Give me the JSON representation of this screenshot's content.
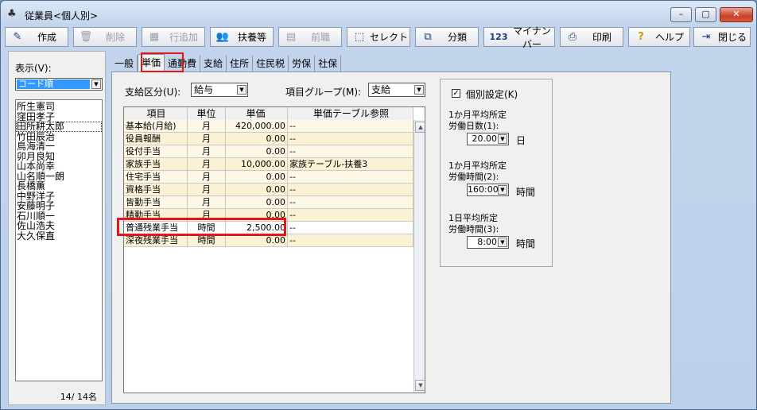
{
  "window": {
    "title": "従業員<個人別>",
    "min": "–",
    "max": "▢",
    "close": "✕"
  },
  "toolbar": {
    "create": "作成",
    "delete": "削除",
    "insert_row": "行追加",
    "dependents": "扶養等",
    "previous_job": "前職",
    "select": "セレクト",
    "classify": "分類",
    "my_number": "マイナンバー",
    "print": "印刷",
    "help": "ヘルプ",
    "close": "閉じる"
  },
  "left": {
    "display_label": "表示(V):",
    "sort_value": "コード順",
    "employees": [
      "所生憲司",
      "窪田孝子",
      "田所耕太郎",
      "竹田辰治",
      "鳥海清一",
      "卯月良知",
      "山本尚幸",
      "山名順一朗",
      "長橋薫",
      "中野洋子",
      "安藤明子",
      "石川順一",
      "佐山浩夫",
      "大久保直"
    ],
    "count": "14/ 14名"
  },
  "tabs": [
    "一般",
    "単価",
    "通勤費",
    "支給",
    "住所",
    "住民税",
    "労保",
    "社保"
  ],
  "form": {
    "pay_type_label": "支給区分(U):",
    "pay_type_value": "給与",
    "item_group_label": "項目グループ(M):",
    "item_group_value": "支給"
  },
  "grid": {
    "headers": [
      "項目",
      "単位",
      "単価",
      "単価テーブル参照"
    ],
    "rows": [
      {
        "item": "基本給(月給)",
        "unit": "月",
        "price": "420,000.00",
        "ref": "--"
      },
      {
        "item": "役員報酬",
        "unit": "月",
        "price": "0.00",
        "ref": "--"
      },
      {
        "item": "役付手当",
        "unit": "月",
        "price": "0.00",
        "ref": "--"
      },
      {
        "item": "家族手当",
        "unit": "月",
        "price": "10,000.00",
        "ref": "家族テーブル-扶養3"
      },
      {
        "item": "住宅手当",
        "unit": "月",
        "price": "0.00",
        "ref": "--"
      },
      {
        "item": "資格手当",
        "unit": "月",
        "price": "0.00",
        "ref": "--"
      },
      {
        "item": "皆勤手当",
        "unit": "月",
        "price": "0.00",
        "ref": "--"
      },
      {
        "item": "精勤手当",
        "unit": "月",
        "price": "0.00",
        "ref": "--"
      },
      {
        "item": "普通残業手当",
        "unit": "時間",
        "price": "2,500.00",
        "ref": "--"
      },
      {
        "item": "深夜残業手当",
        "unit": "時間",
        "price": "0.00",
        "ref": "--"
      }
    ]
  },
  "right": {
    "individual_label": "個別設定(K)",
    "checked_mark": "✓",
    "days_label1": "1か月平均所定",
    "days_label2": "労働日数(1):",
    "days_value": "20.00",
    "days_unit": "日",
    "hours_label1": "1か月平均所定",
    "hours_label2": "労働時間(2):",
    "hours_value": "160:00",
    "hours_unit": "時間",
    "daily_label1": "1日平均所定",
    "daily_label2": "労働時間(3):",
    "daily_value": "8:00",
    "daily_unit": "時間"
  }
}
